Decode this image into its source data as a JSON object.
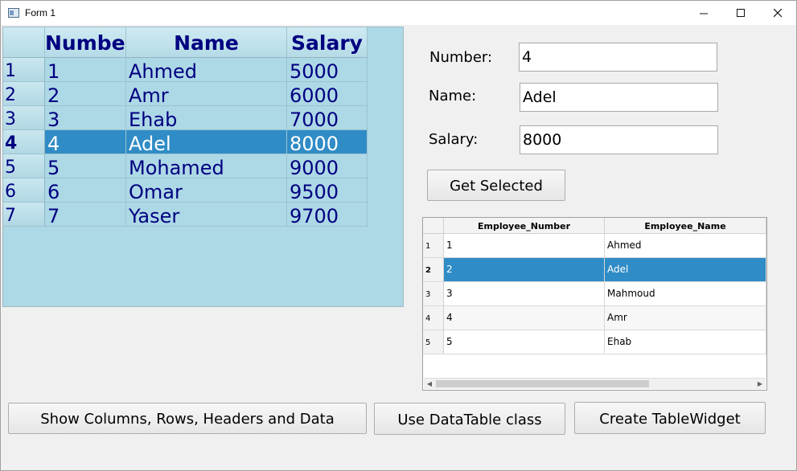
{
  "window": {
    "title": "Form 1"
  },
  "big_table": {
    "headers": [
      "Number",
      "Name",
      "Salary"
    ],
    "rows": [
      {
        "row_label": "1",
        "number": "1",
        "name": "Ahmed",
        "salary": "5000"
      },
      {
        "row_label": "2",
        "number": "2",
        "name": "Amr",
        "salary": "6000"
      },
      {
        "row_label": "3",
        "number": "3",
        "name": "Ehab",
        "salary": "7000"
      },
      {
        "row_label": "4",
        "number": "4",
        "name": "Adel",
        "salary": "8000",
        "selected": true
      },
      {
        "row_label": "5",
        "number": "5",
        "name": "Mohamed",
        "salary": "9000"
      },
      {
        "row_label": "6",
        "number": "6",
        "name": "Omar",
        "salary": "9500"
      },
      {
        "row_label": "7",
        "number": "7",
        "name": "Yaser",
        "salary": "9700"
      }
    ]
  },
  "form": {
    "number_label": "Number:",
    "number_value": "4",
    "name_label": "Name:",
    "name_value": "Adel",
    "salary_label": "Salary:",
    "salary_value": "8000",
    "get_selected_label": "Get Selected"
  },
  "small_table": {
    "headers": [
      "Employee_Number",
      "Employee_Name"
    ],
    "rows": [
      {
        "row_label": "1",
        "number": "1",
        "name": "Ahmed"
      },
      {
        "row_label": "2",
        "number": "2",
        "name": "Adel",
        "selected": true
      },
      {
        "row_label": "3",
        "number": "3",
        "name": "Mahmoud"
      },
      {
        "row_label": "4",
        "number": "4",
        "name": "Amr"
      },
      {
        "row_label": "5",
        "number": "5",
        "name": "Ehab"
      }
    ]
  },
  "buttons": {
    "show_columns": "Show Columns, Rows, Headers and Data",
    "use_datatable": "Use DataTable class",
    "create_tablewidget": "Create TableWidget"
  }
}
